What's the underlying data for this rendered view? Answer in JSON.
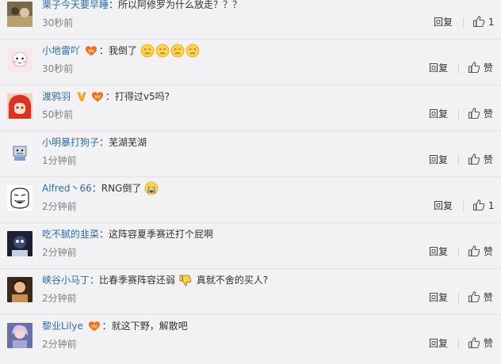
{
  "comments": [
    {
      "user": "栗子今天要早睡",
      "colon": "：",
      "text": "所以阿修罗为什么放走？？？",
      "time": "30秒前",
      "reply_label": "回复",
      "like_label": "1"
    },
    {
      "user": "小地雷吖",
      "colon": "：",
      "text": "我倒了",
      "time": "30秒前",
      "reply_label": "回复",
      "like_label": "赞"
    },
    {
      "user": "渡鸦羽",
      "colon": "：",
      "text": "打得过v5吗?",
      "time": "50秒前",
      "reply_label": "回复",
      "like_label": "赞"
    },
    {
      "user": "小明暴打狗子",
      "colon": "：",
      "text": "芜湖芜湖",
      "time": "1分钟前",
      "reply_label": "回复",
      "like_label": "赞"
    },
    {
      "user": "Alfred丶66",
      "colon": "：",
      "text": "RNG倒了",
      "time": "2分钟前",
      "reply_label": "回复",
      "like_label": "1"
    },
    {
      "user": "吃不腻的韭菜",
      "colon": "：",
      "text": "这阵容夏季赛还打个屁啊",
      "time": "2分钟前",
      "reply_label": "回复",
      "like_label": "赞"
    },
    {
      "user": "峡谷小马丁",
      "colon": "：",
      "text": "比春季赛阵容还弱",
      "text2": "真就不舍的买人?",
      "time": "2分钟前",
      "reply_label": "回复",
      "like_label": "赞"
    },
    {
      "user": "黎业Lilye",
      "colon": "：",
      "text": "就这下野，解散吧",
      "time": "2分钟前",
      "reply_label": "回复",
      "like_label": "赞"
    }
  ],
  "icons": {
    "like": "thumbs-up-icon",
    "vip_badge": "vip-heart-badge-icon",
    "verified": "verified-v-icon",
    "emoji_sad": "sad-face-emoji",
    "emoji_cry": "crying-face-emoji",
    "emoji_thumbsdown": "thumbs-down-emoji"
  },
  "colors": {
    "username": "#2d6da9",
    "background": "#f2f2f5",
    "time": "#808080"
  }
}
